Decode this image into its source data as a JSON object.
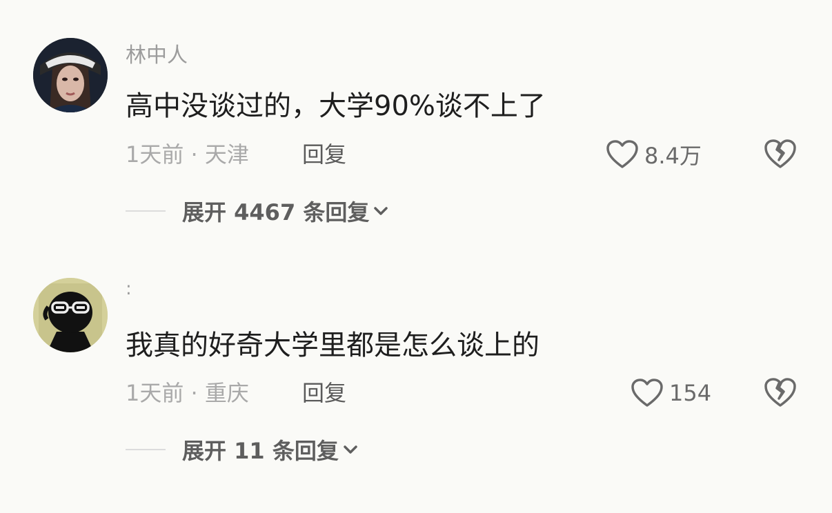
{
  "comments": [
    {
      "username": "林中人",
      "content": "高中没谈过的，大学90%谈不上了",
      "meta": "1天前 · 天津",
      "reply_label": "回复",
      "likes": "8.4万",
      "expand_label": "展开 4467 条回复"
    },
    {
      "username": ":",
      "content": "我真的好奇大学里都是怎么谈上的",
      "meta": "1天前 · 重庆",
      "reply_label": "回复",
      "likes": "154",
      "expand_label": "展开 11 条回复"
    }
  ],
  "icons": {
    "like": "heart-outline-icon",
    "dislike": "broken-heart-icon",
    "expand": "chevron-down-icon"
  },
  "colors": {
    "background": "#fafaf7",
    "text_primary": "#1e1e1e",
    "text_secondary": "#a9a9a9",
    "icon": "#6a6a6a"
  }
}
